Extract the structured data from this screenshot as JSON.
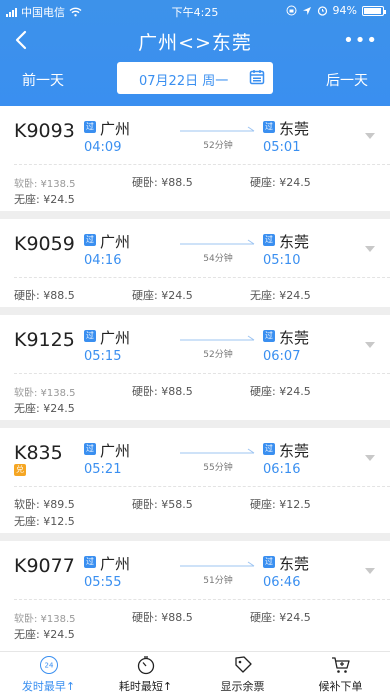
{
  "status": {
    "carrier": "中国电信",
    "time": "下午4:25",
    "battery": "94%"
  },
  "header": {
    "title": "广州<>东莞",
    "back_icon": "back-arrow-icon",
    "more_icon": "more-dots-icon"
  },
  "date_bar": {
    "prev": "前一天",
    "date": "07月22日 周一",
    "next": "后一天"
  },
  "trains": [
    {
      "no": "K9093",
      "tag": "过",
      "from": "广州",
      "dep": "04:09",
      "to": "东莞",
      "arr": "05:01",
      "duration": "52分钟",
      "prices": [
        [
          "软卧: ¥138.5",
          "硬卧: ¥88.5",
          "硬座: ¥24.5"
        ],
        [
          "无座: ¥24.5"
        ]
      ]
    },
    {
      "no": "K9059",
      "tag": "过",
      "from": "广州",
      "dep": "04:16",
      "to": "东莞",
      "arr": "05:10",
      "duration": "54分钟",
      "prices": [
        [
          "硬卧: ¥88.5",
          "硬座: ¥24.5",
          "无座: ¥24.5"
        ]
      ]
    },
    {
      "no": "K9125",
      "tag": "过",
      "from": "广州",
      "dep": "05:15",
      "to": "东莞",
      "arr": "06:07",
      "duration": "52分钟",
      "prices": [
        [
          "软卧: ¥138.5",
          "硬卧: ¥88.5",
          "硬座: ¥24.5"
        ],
        [
          "无座: ¥24.5"
        ]
      ]
    },
    {
      "no": "K835",
      "tag": "过",
      "extra_tag": "兑",
      "from": "广州",
      "dep": "05:21",
      "to": "东莞",
      "arr": "06:16",
      "duration": "55分钟",
      "prices": [
        [
          "软卧: ¥89.5",
          "硬卧: ¥58.5",
          "硬座: ¥12.5"
        ],
        [
          "无座: ¥12.5"
        ]
      ]
    },
    {
      "no": "K9077",
      "tag": "过",
      "from": "广州",
      "dep": "05:55",
      "to": "东莞",
      "arr": "06:46",
      "duration": "51分钟",
      "prices": [
        [
          "软卧: ¥138.5",
          "硬卧: ¥88.5",
          "硬座: ¥24.5"
        ],
        [
          "无座: ¥24.5"
        ]
      ]
    }
  ],
  "tabs": [
    {
      "label": "发时最早↑",
      "icon": "clock-24-icon",
      "badge": "24",
      "active": true
    },
    {
      "label": "耗时最短↑",
      "icon": "stopwatch-icon",
      "active": false
    },
    {
      "label": "显示余票",
      "icon": "ticket-tag-icon",
      "active": false
    },
    {
      "label": "候补下单",
      "icon": "cart-add-icon",
      "active": false
    }
  ],
  "colors": {
    "primary": "#3a8ff0",
    "tag_orange": "#f5a623"
  }
}
